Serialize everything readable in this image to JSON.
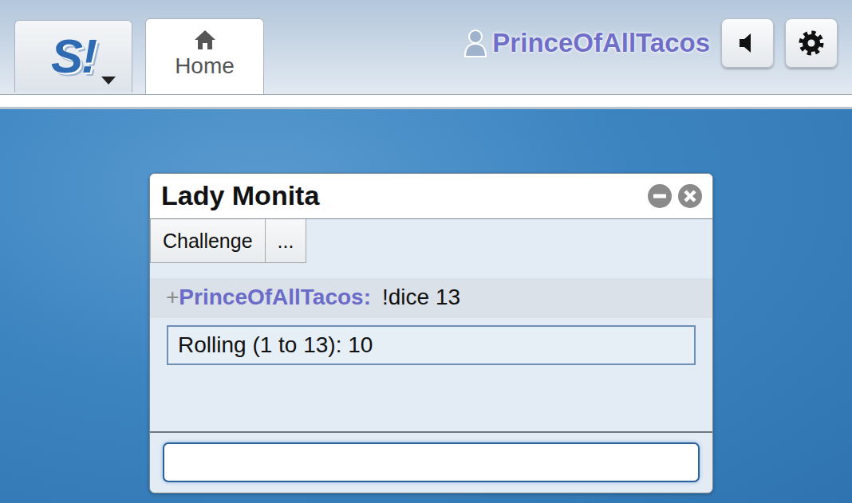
{
  "header": {
    "logo_text": "S!",
    "tabs": [
      {
        "label": "Home",
        "selected": true
      }
    ],
    "user": {
      "name": "PrinceOfAllTacos"
    }
  },
  "window": {
    "title": "Lady Monita",
    "buttons": [
      "Challenge",
      "..."
    ],
    "messages": [
      {
        "rank": "+",
        "user": "PrinceOfAllTacos:",
        "text": "!dice 13",
        "color": "#6b6bc9"
      }
    ],
    "results": [
      "Rolling (1 to 13): 10"
    ],
    "input": {
      "value": ""
    }
  }
}
